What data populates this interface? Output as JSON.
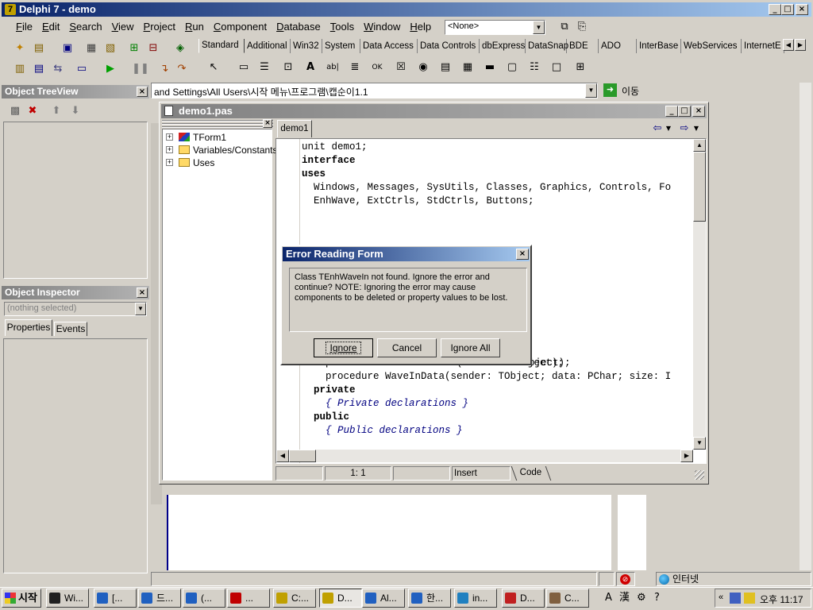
{
  "app": {
    "title": "Delphi 7 - demo"
  },
  "menu": [
    "File",
    "Edit",
    "Search",
    "View",
    "Project",
    "Run",
    "Component",
    "Database",
    "Tools",
    "Window",
    "Help"
  ],
  "component_selector": {
    "value": "<None>"
  },
  "palette_tabs": [
    "Standard",
    "Additional",
    "Win32",
    "System",
    "Data Access",
    "Data Controls",
    "dbExpress",
    "DataSnap",
    "BDE",
    "ADO",
    "InterBase",
    "WebServices",
    "InternetE"
  ],
  "address": {
    "value": "and Settings\\All Users\\시작 메뉴\\프로그램\\캡순이1.1",
    "go_label": "이동"
  },
  "tree_view": {
    "title": "Object TreeView"
  },
  "inspector": {
    "title": "Object Inspector",
    "selection": "(nothing selected)",
    "tabs": [
      "Properties",
      "Events"
    ]
  },
  "editor": {
    "title": "demo1.pas",
    "tab": "demo1",
    "explorer": [
      "TForm1",
      "Variables/Constants",
      "Uses"
    ],
    "status": {
      "position": "1:  1",
      "mode": "Insert",
      "view_tab": "Code"
    },
    "code_top": [
      "unit demo1;",
      "",
      "interface",
      "",
      "uses",
      "  Windows, Messages, SysUtils, Classes, Graphics, Controls, Fo",
      "  EnhWave, ExtCtrls, StdCtrls, Buttons;"
    ],
    "code_bottom": [
      "    procedure BTCloseClick(Sender: TObject);",
      "    procedure WaveInData(sender: TObject; data: PChar; size: I",
      "  private",
      "    { Private declarations }",
      "  public",
      "    { Public declarations }"
    ],
    "partial": "bject);"
  },
  "dialog": {
    "title": "Error Reading Form",
    "message": "Class TEnhWaveIn not found.  Ignore the error and continue?  NOTE: Ignoring the error may cause components to be deleted or property values to be lost.",
    "buttons": {
      "ignore": "Ignore",
      "cancel": "Cancel",
      "ignore_all": "Ignore All"
    }
  },
  "statusbar": {
    "zone": "인터넷"
  },
  "taskbar": {
    "start": "시작",
    "clock": "오후 11:17",
    "items": [
      "Wi...",
      "[...",
      "드...",
      "(...",
      "...",
      "C:...",
      "D...",
      "Al...",
      "한...",
      "in...",
      "D...",
      "C..."
    ]
  },
  "colors": {
    "active_title": "#0a246a",
    "inactive_title": "#808080",
    "face": "#d4d0c8"
  }
}
